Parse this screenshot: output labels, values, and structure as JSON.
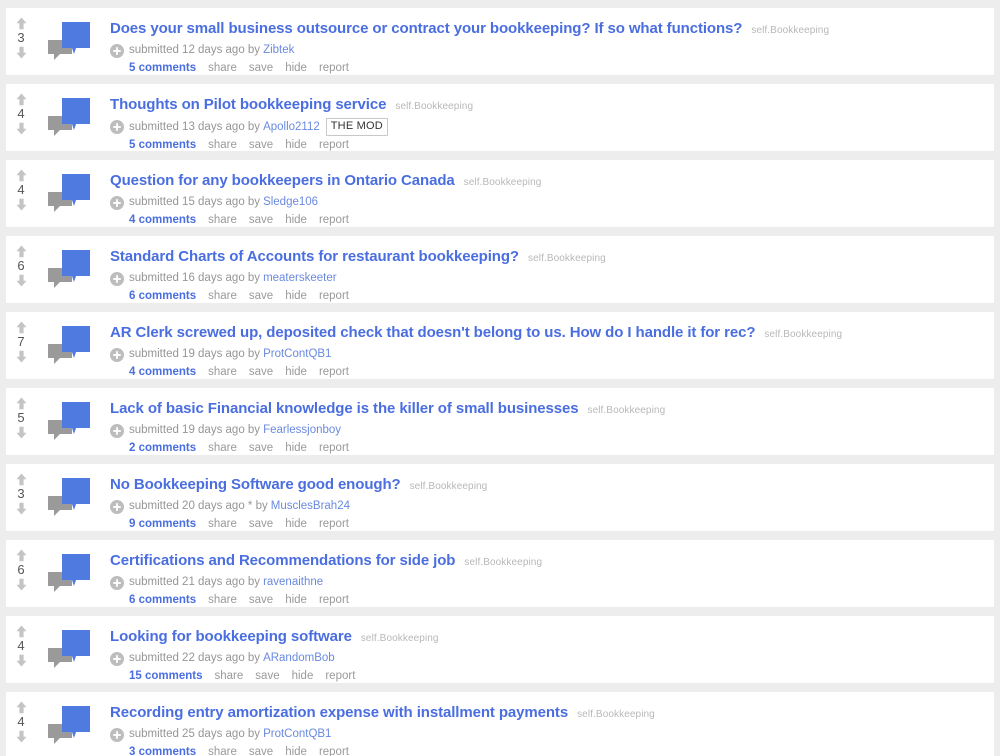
{
  "colors": {
    "page_background": "#ededed",
    "card_background": "#ffffff",
    "title_link": "#4a6ee0",
    "author_link": "#6a8ae0",
    "muted_text": "#969696",
    "domain_text": "#b8b8b8",
    "thumb_blue": "#4f7ae0",
    "thumb_gray": "#9a9a9a",
    "arrow_gray": "#c4c4c4"
  },
  "icons": {
    "upvote": "upvote-arrow-icon",
    "downvote": "downvote-arrow-icon",
    "expand": "expand-plus-icon",
    "thumbnail": "self-post-comment-bubble-icon"
  },
  "actions": {
    "share": "share",
    "save": "save",
    "hide": "hide",
    "report": "report"
  },
  "posts": [
    {
      "score": "3",
      "title": "Does your small business outsource or contract your bookkeeping? If so what functions?",
      "domain": "self.Bookkeeping",
      "submitted": "submitted 12 days ago by",
      "author": "Zibtek",
      "flair": "",
      "comments": "5 comments"
    },
    {
      "score": "4",
      "title": "Thoughts on Pilot bookkeeping service",
      "domain": "self.Bookkeeping",
      "submitted": "submitted 13 days ago by",
      "author": "Apollo2112",
      "flair": "THE MOD",
      "comments": "5 comments"
    },
    {
      "score": "4",
      "title": "Question for any bookkeepers in Ontario Canada",
      "domain": "self.Bookkeeping",
      "submitted": "submitted 15 days ago by",
      "author": "Sledge106",
      "flair": "",
      "comments": "4 comments"
    },
    {
      "score": "6",
      "title": "Standard Charts of Accounts for restaurant bookkeeping?",
      "domain": "self.Bookkeeping",
      "submitted": "submitted 16 days ago by",
      "author": "meaterskeeter",
      "flair": "",
      "comments": "6 comments"
    },
    {
      "score": "7",
      "title": "AR Clerk screwed up, deposited check that doesn't belong to us. How do I handle it for rec?",
      "domain": "self.Bookkeeping",
      "submitted": "submitted 19 days ago by",
      "author": "ProtContQB1",
      "flair": "",
      "comments": "4 comments"
    },
    {
      "score": "5",
      "title": "Lack of basic Financial knowledge is the killer of small businesses",
      "domain": "self.Bookkeeping",
      "submitted": "submitted 19 days ago by",
      "author": "Fearlessjonboy",
      "flair": "",
      "comments": "2 comments"
    },
    {
      "score": "3",
      "title": "No Bookkeeping Software good enough?",
      "domain": "self.Bookkeeping",
      "submitted": "submitted 20 days ago * by",
      "author": "MusclesBrah24",
      "flair": "",
      "comments": "9 comments"
    },
    {
      "score": "6",
      "title": "Certifications and Recommendations for side job",
      "domain": "self.Bookkeeping",
      "submitted": "submitted 21 days ago by",
      "author": "ravenaithne",
      "flair": "",
      "comments": "6 comments"
    },
    {
      "score": "4",
      "title": "Looking for bookkeeping software",
      "domain": "self.Bookkeeping",
      "submitted": "submitted 22 days ago by",
      "author": "ARandomBob",
      "flair": "",
      "comments": "15 comments"
    },
    {
      "score": "4",
      "title": "Recording entry amortization expense with installment payments",
      "domain": "self.Bookkeeping",
      "submitted": "submitted 25 days ago by",
      "author": "ProtContQB1",
      "flair": "",
      "comments": "3 comments"
    }
  ]
}
